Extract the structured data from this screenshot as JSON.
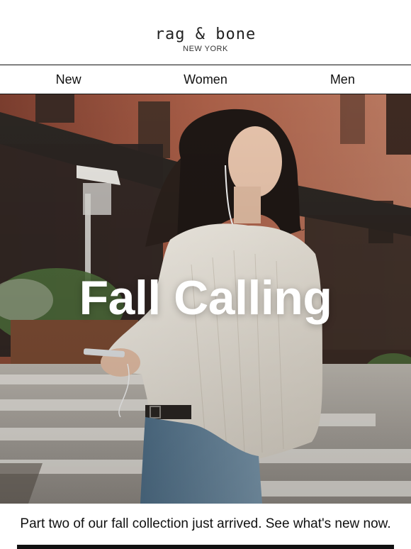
{
  "brand": {
    "logo": "rag & bone",
    "sublogo": "NEW YORK"
  },
  "nav": {
    "items": [
      {
        "label": "New"
      },
      {
        "label": "Women"
      },
      {
        "label": "Men"
      }
    ]
  },
  "hero": {
    "title": "Fall Calling",
    "image_subject": "woman in cream cable-knit sweater and jeans crossing a city street"
  },
  "tagline": "Part two of our fall collection just arrived. See what's new now.",
  "colors": {
    "brick": "#9a5340",
    "sweater": "#ece7de",
    "denim": "#5f7f98",
    "text": "#111111"
  }
}
